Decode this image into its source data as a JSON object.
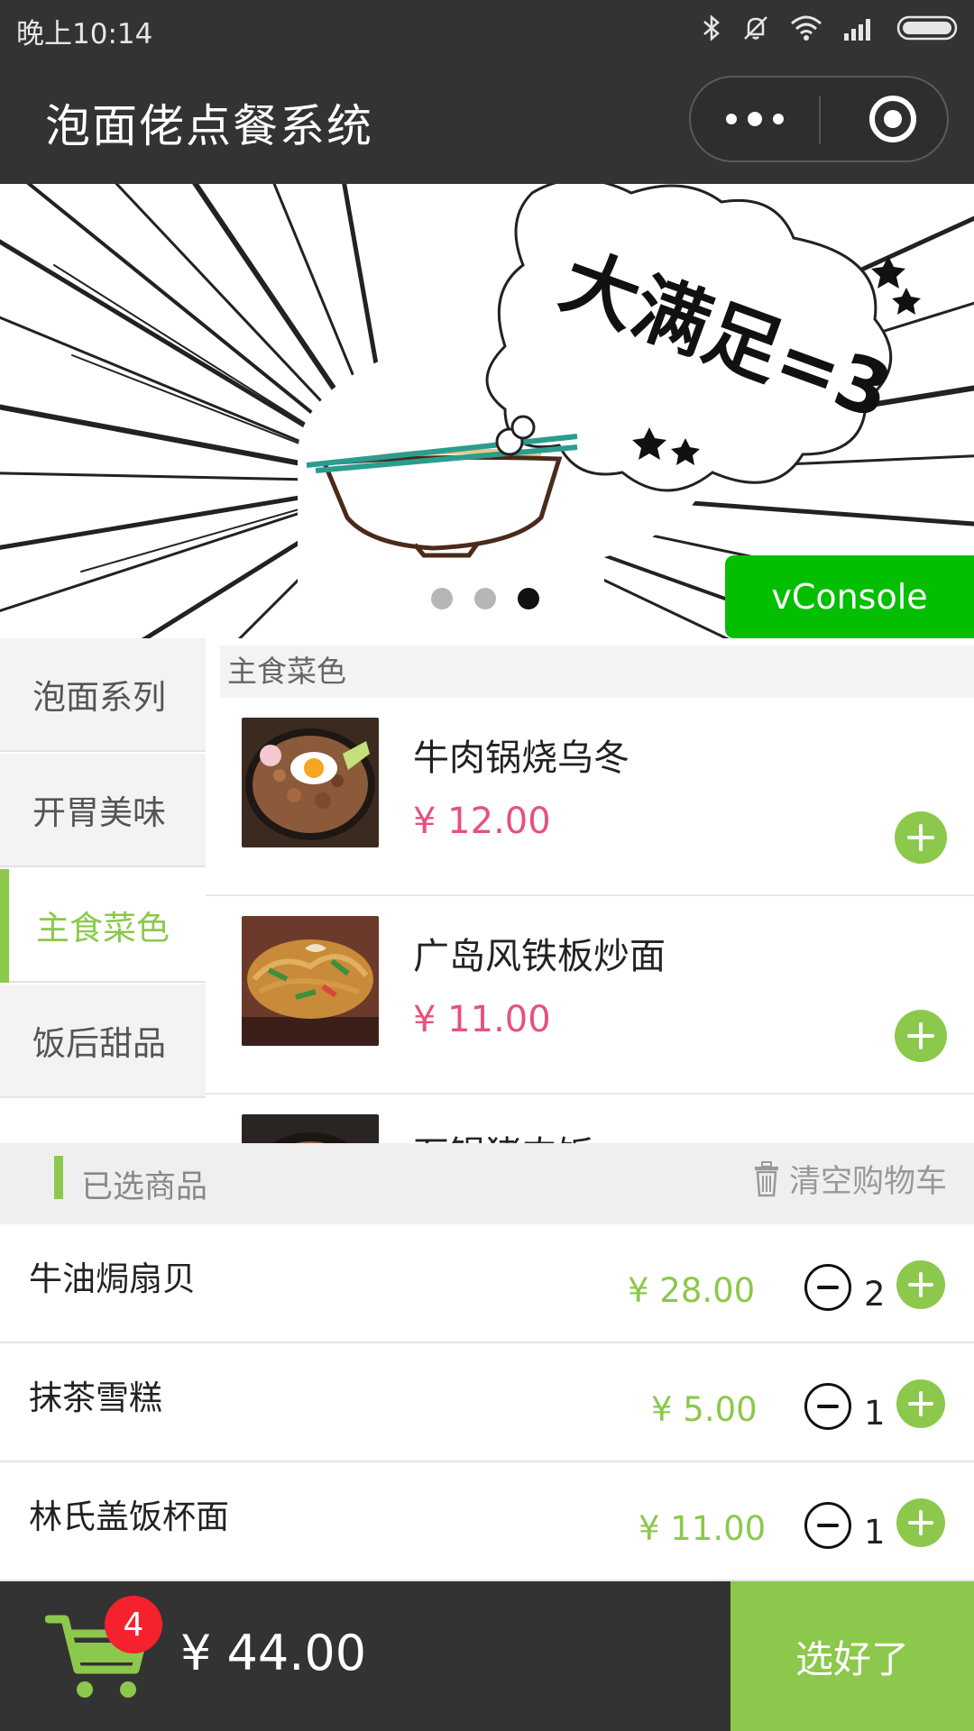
{
  "status_bar": {
    "time": "晚上10:14"
  },
  "header": {
    "title": "泡面佬点餐系统"
  },
  "banner": {
    "caption": "大满足=3",
    "active_dot": 3,
    "dot_count": 3
  },
  "vconsole": {
    "label": "vConsole"
  },
  "categories": [
    {
      "label": "泡面系列",
      "active": false
    },
    {
      "label": "开胃美味",
      "active": false
    },
    {
      "label": "主食菜色",
      "active": true
    },
    {
      "label": "饭后甜品",
      "active": false
    }
  ],
  "dish_section": {
    "title": "主食菜色",
    "items": [
      {
        "name": "牛肉锅烧乌冬",
        "price": "¥ 12.00"
      },
      {
        "name": "广岛风铁板炒面",
        "price": "¥ 11.00"
      },
      {
        "name": "石锅猪肉饭",
        "price": ""
      }
    ]
  },
  "selected": {
    "title": "已选商品",
    "clear_label": "清空购物车",
    "items": [
      {
        "name": "牛油焗扇贝",
        "price": "¥ 28.00",
        "qty": "2"
      },
      {
        "name": "抹茶雪糕",
        "price": "¥ 5.00",
        "qty": "1"
      },
      {
        "name": "林氏盖饭杯面",
        "price": "¥ 11.00",
        "qty": "1"
      }
    ]
  },
  "footer": {
    "cart_count": "4",
    "total": "¥ 44.00",
    "checkout_label": "选好了"
  },
  "colors": {
    "accent": "#8cc84b",
    "price": "#e6527d",
    "dark": "#333333",
    "badge": "#f5222d",
    "vconsole": "#04be02"
  }
}
